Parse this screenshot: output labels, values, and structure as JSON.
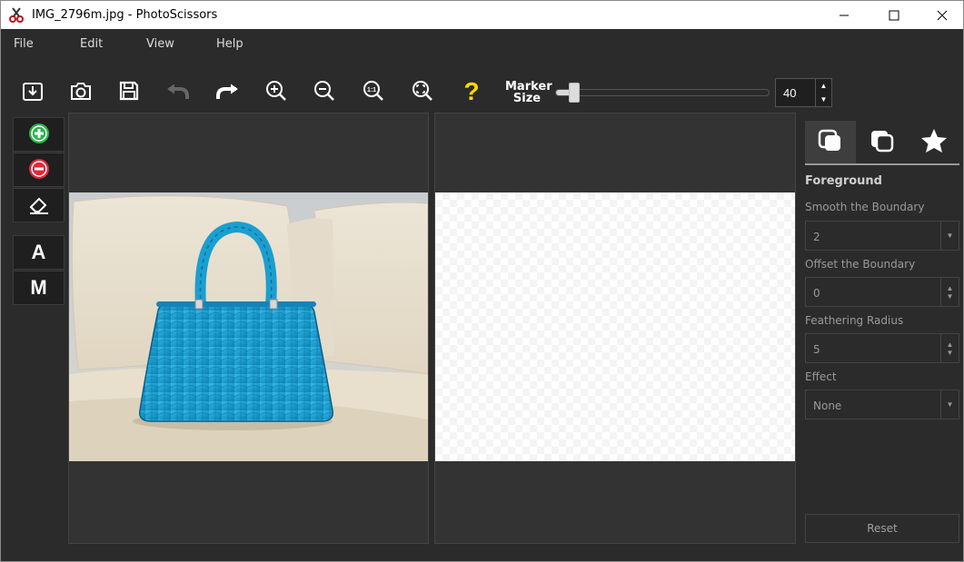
{
  "window": {
    "title": "IMG_2796m.jpg - PhotoScissors",
    "app_icon": "scissors-app-icon"
  },
  "menu": {
    "items": [
      {
        "label": "File"
      },
      {
        "label": "Edit"
      },
      {
        "label": "View"
      },
      {
        "label": "Help"
      }
    ]
  },
  "toolbar": {
    "icons": [
      "open-icon",
      "camera-icon",
      "save-icon",
      "undo-icon",
      "redo-icon",
      "zoom-in-icon",
      "zoom-out-icon",
      "zoom-actual-icon",
      "zoom-fit-icon",
      "help-icon"
    ],
    "marker_size_label": "Marker\nSize",
    "marker_size_value": "40",
    "marker_size_fraction": 0.05
  },
  "left_tools": {
    "icons": [
      "foreground-marker-icon",
      "background-marker-icon",
      "eraser-icon"
    ],
    "mode_auto": "A",
    "mode_manual": "M"
  },
  "right_panel": {
    "tabs": [
      "foreground-tab-icon",
      "background-tab-icon",
      "effects-star-icon"
    ],
    "section_title": "Foreground",
    "smooth_label": "Smooth the Boundary",
    "smooth_value": "2",
    "offset_label": "Offset the Boundary",
    "offset_value": "0",
    "feather_label": "Feathering Radius",
    "feather_value": "5",
    "effect_label": "Effect",
    "effect_value": "None",
    "reset_label": "Reset"
  },
  "colors": {
    "bg_dark": "#2b2b2b",
    "accent_green": "#2bb34a",
    "accent_red": "#e0283a",
    "help_yellow": "#ffd800",
    "bag_blue": "#1a9fd0"
  }
}
